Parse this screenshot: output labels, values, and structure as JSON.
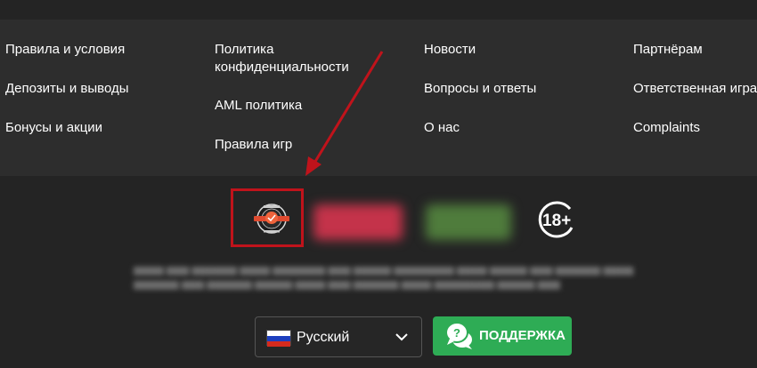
{
  "footer": {
    "columns": [
      {
        "links": [
          "Правила и условия",
          "Депозиты и выводы",
          "Бонусы и акции"
        ]
      },
      {
        "links": [
          "Политика конфиденциальности",
          "AML политика",
          "Правила игр"
        ]
      },
      {
        "links": [
          "Новости",
          "Вопросы и ответы",
          "О нас"
        ]
      },
      {
        "links": [
          "Партнёрам",
          "Ответственная игра",
          "Complaints"
        ]
      }
    ]
  },
  "badges": {
    "license_icon": "license-seal-icon",
    "age_restriction": "18+",
    "highlight_color": "#c0131b"
  },
  "language_selector": {
    "selected": "Русский",
    "flag_icon": "russia-flag-icon"
  },
  "support": {
    "label": "ПОДДЕРЖКА",
    "icon": "chat-bubbles-icon",
    "color": "#2eac55"
  },
  "annotation": {
    "arrow_color": "#c0131b"
  }
}
